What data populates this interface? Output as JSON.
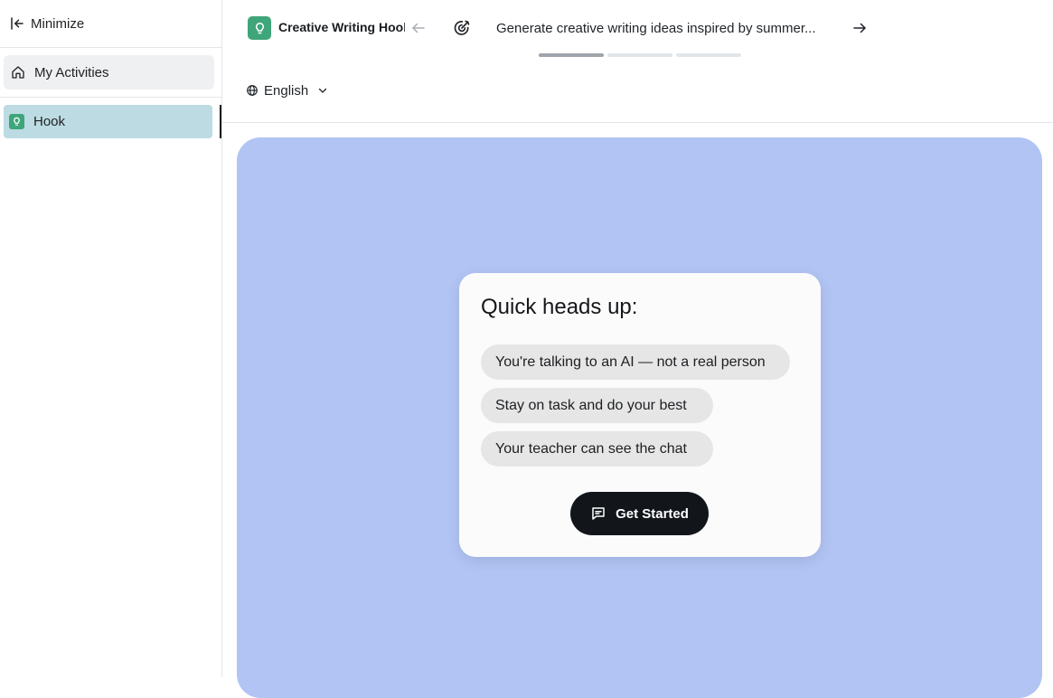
{
  "sidebar": {
    "minimize_label": "Minimize",
    "items": [
      {
        "label": "My Activities",
        "icon": "home-icon"
      },
      {
        "label": "Hook",
        "icon": "lightbulb-icon",
        "active": true
      }
    ]
  },
  "header": {
    "app_title": "Creative Writing Hook",
    "step_text": "Generate creative writing ideas inspired by summer...",
    "progress": {
      "completed_steps": 1,
      "total_steps": 3
    },
    "language": "English"
  },
  "main": {
    "card_title": "Quick heads up:",
    "notices": [
      "You're talking to an AI — not a real person",
      "Stay on task and do your best",
      "Your teacher can see the chat"
    ],
    "start_button_label": "Get Started"
  },
  "colors": {
    "accent_green": "#3fa57a",
    "stage_background": "#b2c4f3",
    "active_nav": "#bcdbe3",
    "button_dark": "#12161b"
  }
}
